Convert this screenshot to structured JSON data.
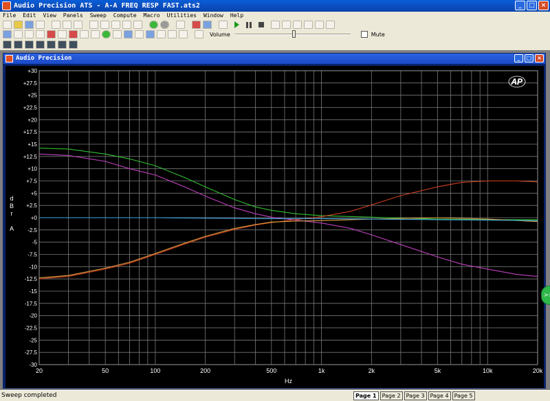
{
  "app": {
    "title": "Audio Precision ATS  -  A-A FREQ RESP FAST.ats2",
    "window_buttons": {
      "minimize": "_",
      "maximize": "□",
      "close": "×"
    }
  },
  "menu": [
    {
      "label": "File"
    },
    {
      "label": "Edit"
    },
    {
      "label": "View"
    },
    {
      "label": "Panels"
    },
    {
      "label": "Sweep"
    },
    {
      "label": "Compute"
    },
    {
      "label": "Macro"
    },
    {
      "label": "Utilities"
    },
    {
      "label": "Window"
    },
    {
      "label": "Help"
    }
  ],
  "toolbar": {
    "volume_label": "Volume",
    "volume_level": 0.51,
    "mute_label": "Mute",
    "mute_checked": false
  },
  "child_window": {
    "title": "Audio Precision",
    "logo": "AP"
  },
  "chart_data": {
    "type": "line",
    "xscale": "log",
    "xlim": [
      20,
      20000
    ],
    "ylim": [
      -30,
      30
    ],
    "xlabel": "Hz",
    "ylabel_letters": [
      "d",
      "B",
      "r",
      "",
      "A"
    ],
    "grid": true,
    "background": "#000000",
    "grid_color": "#7a7a7a",
    "xticks": [
      {
        "v": 20,
        "label": "20"
      },
      {
        "v": 50,
        "label": "50"
      },
      {
        "v": 100,
        "label": "100"
      },
      {
        "v": 200,
        "label": "200"
      },
      {
        "v": 500,
        "label": "500"
      },
      {
        "v": 1000,
        "label": "1k"
      },
      {
        "v": 2000,
        "label": "2k"
      },
      {
        "v": 5000,
        "label": "5k"
      },
      {
        "v": 10000,
        "label": "10k"
      },
      {
        "v": 20000,
        "label": "20k"
      }
    ],
    "yticks": [
      "+30",
      "+27.5",
      "+25",
      "+22.5",
      "+20",
      "+17.5",
      "+15",
      "+12.5",
      "+10",
      "+7.5",
      "+5",
      "+2.5",
      "+0",
      "-2.5",
      "-5",
      "-7.5",
      "-10",
      "-12.5",
      "-15",
      "-17.5",
      "-20",
      "-22.5",
      "-25",
      "-27.5",
      "-30"
    ],
    "series": [
      {
        "color": "#30c030",
        "x": [
          20,
          30,
          50,
          70,
          100,
          150,
          200,
          300,
          400,
          500,
          700,
          1000,
          2000,
          5000,
          10000,
          20000
        ],
        "y": [
          14.2,
          14,
          13,
          12,
          10.6,
          8.2,
          6.3,
          3.7,
          2.2,
          1.5,
          0.8,
          0.4,
          0.1,
          -0.3,
          -0.4,
          -0.4
        ]
      },
      {
        "color": "#c040c0",
        "x": [
          20,
          30,
          50,
          70,
          100,
          150,
          200,
          300,
          400,
          500,
          700,
          1000,
          1500,
          2000,
          3000,
          5000,
          7000,
          10000,
          15000,
          20000
        ],
        "y": [
          13,
          12.7,
          11.5,
          10,
          8.7,
          6.3,
          4.4,
          2,
          0.8,
          0.1,
          -0.5,
          -1.1,
          -2.2,
          -3.5,
          -5.5,
          -8,
          -9.5,
          -10.5,
          -11.6,
          -12
        ]
      },
      {
        "color": "#d04020",
        "x": [
          20,
          30,
          50,
          70,
          100,
          150,
          200,
          300,
          400,
          500,
          700,
          1000,
          1500,
          2000,
          3000,
          5000,
          7000,
          10000,
          15000,
          20000
        ],
        "y": [
          -12.5,
          -12,
          -10.5,
          -9.3,
          -7.5,
          -5.4,
          -4,
          -2.4,
          -1.5,
          -1,
          -0.4,
          0.2,
          1.3,
          2.6,
          4.5,
          6.3,
          7.2,
          7.5,
          7.5,
          7.3
        ]
      },
      {
        "color": "#e0a040",
        "x": [
          20,
          30,
          50,
          70,
          100,
          150,
          200,
          300,
          400,
          500,
          700,
          1000,
          2000,
          5000,
          10000,
          20000
        ],
        "y": [
          -12.3,
          -11.8,
          -10.3,
          -9.1,
          -7.3,
          -5.2,
          -3.8,
          -2.2,
          -1.4,
          -0.9,
          -0.7,
          -0.6,
          -0.3,
          0,
          -0.3,
          -0.8
        ]
      },
      {
        "color": "#40a8e0",
        "x": [
          20,
          50,
          100,
          200,
          500,
          1000,
          2000,
          5000,
          10000,
          20000
        ],
        "y": [
          0,
          0,
          0,
          -0.1,
          -0.2,
          -0.2,
          -0.3,
          -0.4,
          -0.5,
          -0.6
        ]
      }
    ]
  },
  "status": {
    "text": "Sweep completed",
    "pages": [
      {
        "label": "Page 1",
        "active": true
      },
      {
        "label": "Page 2",
        "active": false
      },
      {
        "label": "Page 3",
        "active": false
      },
      {
        "label": "Page 4",
        "active": false
      },
      {
        "label": "Page 5",
        "active": false
      }
    ]
  },
  "side_badge": ">>"
}
